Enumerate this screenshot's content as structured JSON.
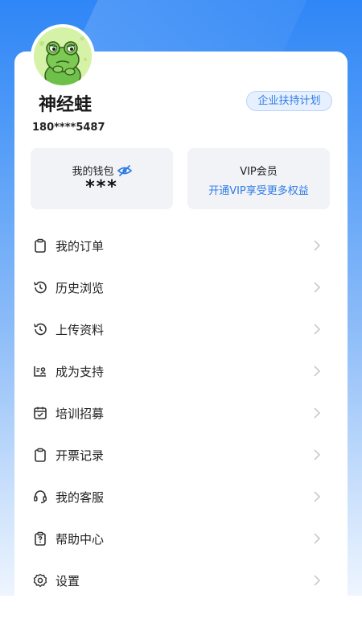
{
  "profile": {
    "name": "神经蛙",
    "phone": "180****5487",
    "avatar_icon": "frog-avatar"
  },
  "header": {
    "enterprise_label": "企业扶持计划"
  },
  "wallet": {
    "title": "我的钱包",
    "amount": "***",
    "visibility_icon": "eye-hidden-icon"
  },
  "vip": {
    "title": "VIP会员",
    "subtitle": "开通VIP享受更多权益"
  },
  "menu": {
    "items": [
      {
        "label": "我的订单",
        "icon": "clipboard-icon"
      },
      {
        "label": "历史浏览",
        "icon": "history-icon"
      },
      {
        "label": "上传资料",
        "icon": "history-icon"
      },
      {
        "label": "成为支持",
        "icon": "id-card-icon"
      },
      {
        "label": "培训招募",
        "icon": "calendar-check-icon"
      },
      {
        "label": "开票记录",
        "icon": "clipboard-icon"
      },
      {
        "label": "我的客服",
        "icon": "headset-icon"
      },
      {
        "label": "帮助中心",
        "icon": "help-doc-icon"
      },
      {
        "label": "设置",
        "icon": "gear-icon"
      }
    ]
  },
  "colors": {
    "accent": "#2e7ce6",
    "header_gradient_top": "#2f86f6",
    "box_bg": "#f1f3f6"
  }
}
